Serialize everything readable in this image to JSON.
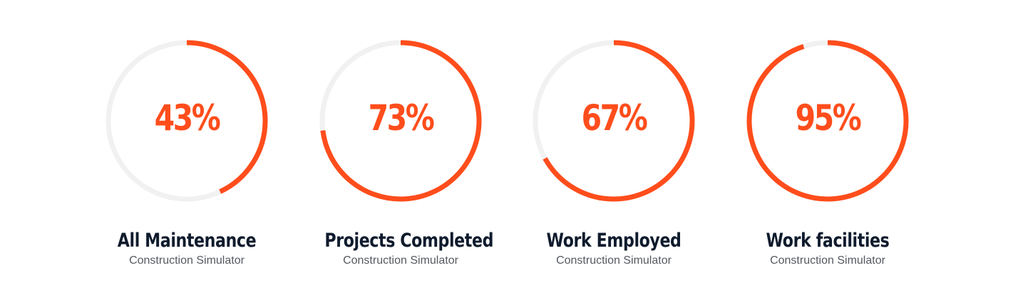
{
  "chart_data": [
    {
      "type": "pie",
      "value": 43,
      "value_label": "43%",
      "title": "All Maintenance",
      "subtitle": "Construction Simulator",
      "max": 100
    },
    {
      "type": "pie",
      "value": 73,
      "value_label": "73%",
      "title": "Projects Completed",
      "subtitle": "Construction Simulator",
      "max": 100
    },
    {
      "type": "pie",
      "value": 67,
      "value_label": "67%",
      "title": "Work Employed",
      "subtitle": "Construction Simulator",
      "max": 100
    },
    {
      "type": "pie",
      "value": 95,
      "value_label": "95%",
      "title": "Work facilities",
      "subtitle": "Construction Simulator",
      "max": 100
    }
  ],
  "colors": {
    "accent": "#ff4d1c",
    "track": "#f1f1f1",
    "title": "#0f1b2d",
    "subtitle": "#555a60"
  }
}
